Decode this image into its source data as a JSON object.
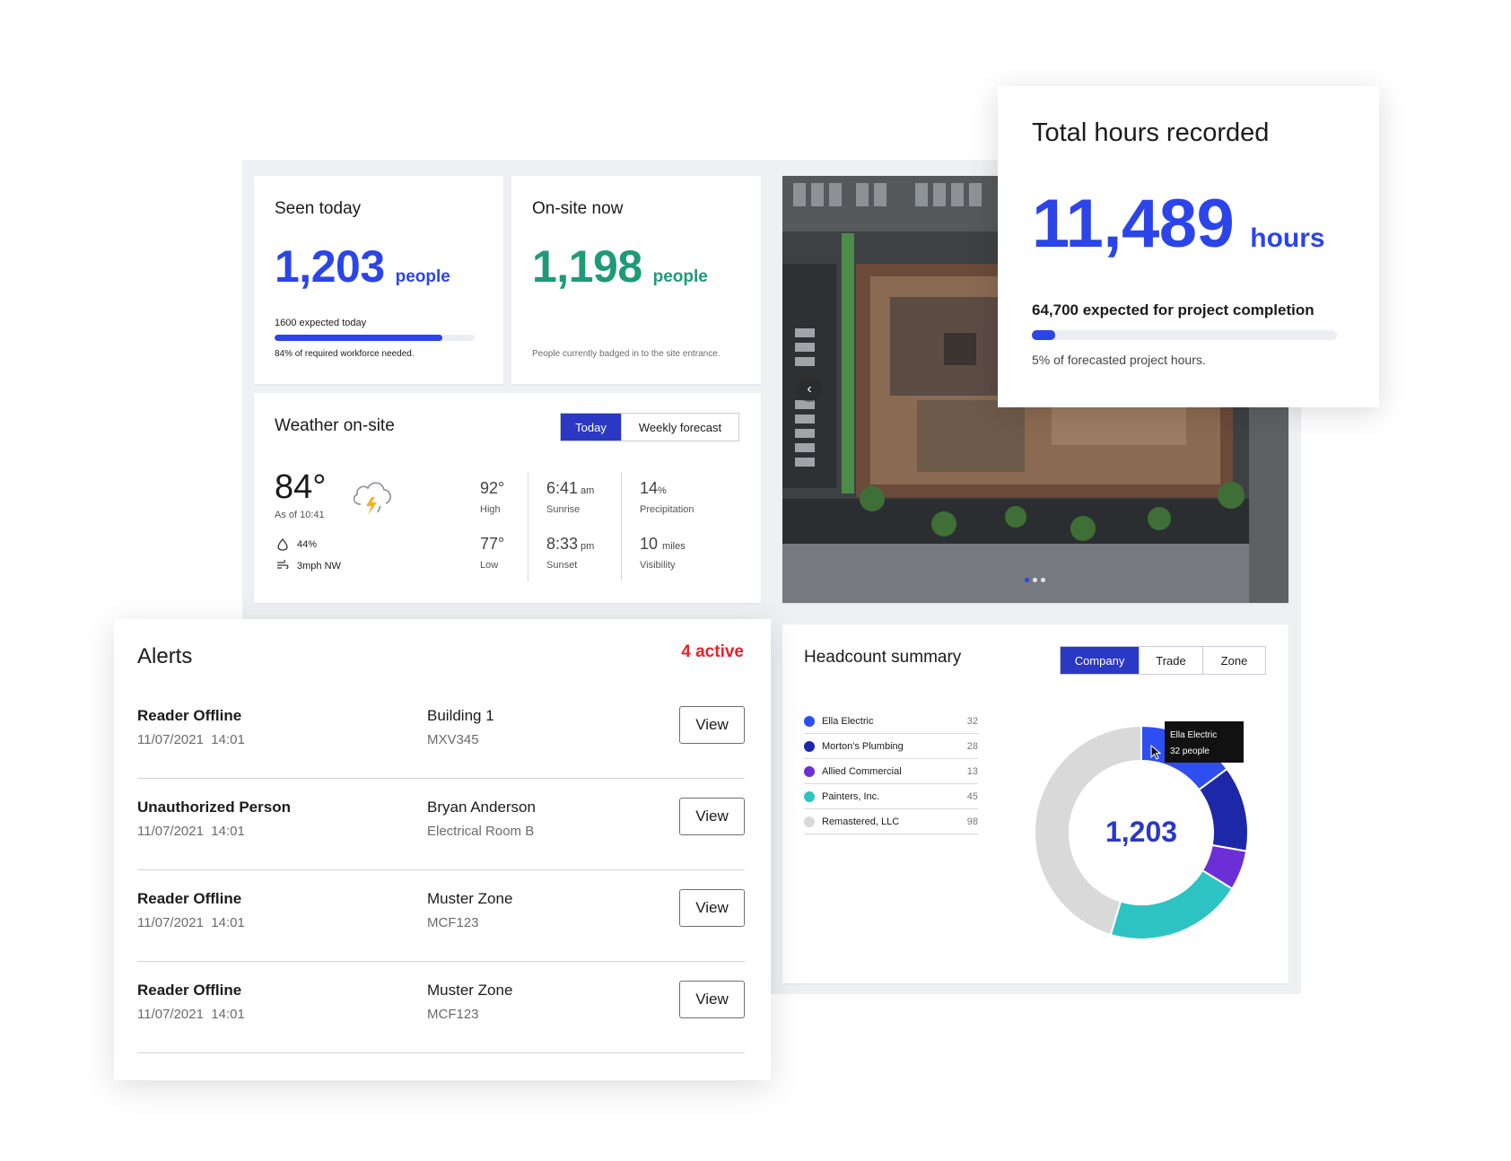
{
  "seen_today": {
    "title": "Seen today",
    "value": "1,203",
    "unit": "people",
    "expected": "1600 expected today",
    "progress": 0.84,
    "note": "84% of required workforce needed."
  },
  "onsite_now": {
    "title": "On-site now",
    "value": "1,198",
    "unit": "people",
    "note": "People currently badged in to the site entrance."
  },
  "total_hours": {
    "title": "Total hours recorded",
    "value": "11,489",
    "unit": "hours",
    "expected": "64,700 expected for project completion",
    "progress": 0.05,
    "note": "5% of forecasted project hours."
  },
  "weather": {
    "title": "Weather on-site",
    "tabs": [
      "Today",
      "Weekly forecast"
    ],
    "active_tab": "Today",
    "current_temp": "84°",
    "as_of": "As of 10:41",
    "humidity": "44%",
    "wind": "3mph NW",
    "icon": "thunderstorm-icon",
    "high": "92°",
    "high_label": "High",
    "low": "77°",
    "low_label": "Low",
    "sunrise": "6:41",
    "sunrise_unit": "am",
    "sunrise_label": "Sunrise",
    "sunset": "8:33",
    "sunset_unit": "pm",
    "sunset_label": "Sunset",
    "precip": "14",
    "precip_unit": "%",
    "precip_label": "Precipitation",
    "visibility": "10",
    "visibility_unit": "miles",
    "visibility_label": "Visibility"
  },
  "photo": {
    "carousel_index": 1,
    "carousel_count": 3
  },
  "headcount": {
    "title": "Headcount summary",
    "tabs": [
      "Company",
      "Trade",
      "Zone"
    ],
    "active_tab": "Company",
    "total": "1,203",
    "tooltip": {
      "name": "Ella Electric",
      "detail": "32 people"
    }
  },
  "chart_data": {
    "type": "pie",
    "categories": [
      "Ella Electric",
      "Morton's Plumbing",
      "Allied Commercial",
      "Painters, Inc.",
      "Remastered, LLC"
    ],
    "values": [
      32,
      28,
      13,
      45,
      98
    ],
    "colors": [
      "#2d4ef0",
      "#1d28a8",
      "#6c2fd6",
      "#2ec3c3",
      "#d9d9d9"
    ],
    "donut_center_label": "1,203",
    "legend_position": "left"
  },
  "alerts": {
    "title": "Alerts",
    "active_count": "4 active",
    "view_label": "View",
    "items": [
      {
        "type": "Reader Offline",
        "date": "11/07/2021",
        "time": "14:01",
        "location": "Building 1",
        "code": "MXV345"
      },
      {
        "type": "Unauthorized Person",
        "date": "11/07/2021",
        "time": "14:01",
        "location": "Bryan Anderson",
        "code": "Electrical Room B"
      },
      {
        "type": "Reader Offline",
        "date": "11/07/2021",
        "time": "14:01",
        "location": "Muster Zone",
        "code": "MCF123"
      },
      {
        "type": "Reader Offline",
        "date": "11/07/2021",
        "time": "14:01",
        "location": "Muster Zone",
        "code": "MCF123"
      }
    ]
  },
  "colors": {
    "accent_blue": "#2b45e8",
    "accent_green": "#1f9a78",
    "alert_red": "#e8202a",
    "segment_active": "#2b38c4"
  }
}
